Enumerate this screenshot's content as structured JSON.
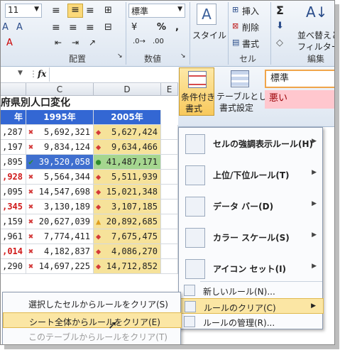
{
  "ribbon": {
    "font_size": "11",
    "alignment_group": "配置",
    "number_format": "標準",
    "number_group": "数値",
    "percent": "%",
    "comma": ",",
    "style_label": "スタイル",
    "cells_insert": "挿入",
    "cells_delete": "削除",
    "cells_format": "書式",
    "cells_group": "セル",
    "sigma": "Σ",
    "sort_filter_line1": "並べ替えと",
    "sort_filter_line2": "フィルター",
    "edit_group": "編集",
    "cond_format_line1": "条件付き",
    "cond_format_line2": "書式",
    "table_format_line1": "テーブルとして",
    "table_format_line2": "書式設定",
    "style_normal": "標準",
    "style_bad": "悪い"
  },
  "formula_bar": {
    "fx": "fx"
  },
  "sheet": {
    "col_c": "C",
    "col_d": "D",
    "col_e": "E",
    "title": "府県別人口変化",
    "header_year_a": "年",
    "header_1995": "1995年",
    "header_2005": "2005年",
    "rows": [
      {
        "a": ",287",
        "c": "5,692,321",
        "d": "5,627,424",
        "c_icon": "x",
        "d_icon": "diamond"
      },
      {
        "a": ",197",
        "c": "9,834,124",
        "d": "9,634,466",
        "c_icon": "x",
        "d_icon": "diamond"
      },
      {
        "a": ",895",
        "c": "39,520,058",
        "d": "41,487,171",
        "c_icon": "check",
        "d_icon": "circle"
      },
      {
        "a": ",928",
        "c": "5,564,344",
        "d": "5,511,939",
        "c_icon": "x",
        "d_icon": "diamond"
      },
      {
        "a": ",095",
        "c": "14,547,698",
        "d": "15,021,348",
        "c_icon": "x",
        "d_icon": "diamond"
      },
      {
        "a": ",345",
        "c": "3,130,189",
        "d": "3,107,185",
        "c_icon": "x",
        "d_icon": "diamond"
      },
      {
        "a": ",159",
        "c": "20,627,039",
        "d": "20,892,685",
        "c_icon": "x",
        "d_icon": "triangle"
      },
      {
        "a": ",961",
        "c": "7,774,411",
        "d": "7,675,475",
        "c_icon": "x",
        "d_icon": "diamond"
      },
      {
        "a": ",014",
        "c": "4,182,837",
        "d": "4,086,270",
        "c_icon": "x",
        "d_icon": "diamond"
      },
      {
        "a": ",290",
        "c": "14,697,225",
        "d": "14,712,852",
        "c_icon": "x",
        "d_icon": "diamond"
      }
    ]
  },
  "menu": {
    "highlight_rules": "セルの強調表示ルール(H)",
    "top_bottom": "上位/下位ルール(T)",
    "data_bar": "データ バー(D)",
    "color_scale": "カラー スケール(S)",
    "icon_set": "アイコン セット(I)",
    "new_rule": "新しいルール(N)...",
    "clear_rules": "ルールのクリア(C)",
    "manage_rules": "ルールの管理(R)..."
  },
  "submenu": {
    "clear_selected": "選択したセルからルールをクリア(S)",
    "clear_sheet": "シート全体からルールをクリア(E)",
    "clear_table": "このテーブルからルールをクリア(T)"
  },
  "colors": {
    "header_blue": "#3367d3",
    "menu_highlight": "#fbe6a4",
    "bad_style": "#ffc7ce"
  }
}
